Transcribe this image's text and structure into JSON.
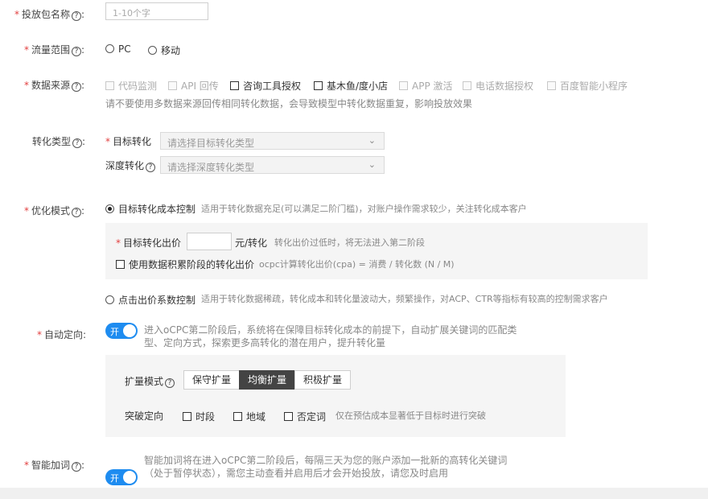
{
  "package_name": {
    "label": "投放包名称",
    "placeholder": "1-10个字"
  },
  "traffic": {
    "label": "流量范围",
    "options": [
      "PC",
      "移动"
    ]
  },
  "data_source": {
    "label": "数据来源",
    "options": [
      "代码监测",
      "API 回传",
      "咨询工具授权",
      "基木鱼/度小店",
      "APP 激活",
      "电话数据授权",
      "百度智能小程序"
    ],
    "note": "请不要使用多数据来源回传相同转化数据，会导致模型中转化数据重复，影响投放效果"
  },
  "conversion_type": {
    "label": "转化类型",
    "target_label": "目标转化",
    "target_placeholder": "请选择目标转化类型",
    "deep_label": "深度转化",
    "deep_placeholder": "请选择深度转化类型"
  },
  "optimization": {
    "label": "优化模式",
    "option1": "目标转化成本控制",
    "option1_desc": "适用于转化数据充足(可以满足二阶门槛)，对账户操作需求较少，关注转化成本客户",
    "bid_label": "目标转化出价",
    "bid_unit": "元/转化",
    "bid_hint": "转化出价过低时，将无法进入第二阶段",
    "accum_label": "使用数据积累阶段的转化出价",
    "accum_formula": "ocpc计算转化出价(cpa) = 消费 / 转化数 (N / M)",
    "option2": "点击出价系数控制",
    "option2_desc": "适用于转化数据稀疏，转化成本和转化量波动大，频繁操作，对ACP、CTR等指标有较高的控制需求客户"
  },
  "auto_targeting": {
    "label": "自动定向",
    "toggle": "开",
    "desc": "进入oCPC第二阶段后，系统将在保障目标转化成本的前提下，自动扩展关键词的匹配类型、定向方式，探索更多高转化的潜在用户，提升转化量",
    "expand_label": "扩量模式",
    "expand_modes": [
      "保守扩量",
      "均衡扩量",
      "积极扩量"
    ],
    "breakthrough_label": "突破定向",
    "breakthrough_options": [
      "时段",
      "地域",
      "否定词"
    ],
    "breakthrough_hint": "仅在预估成本显著低于目标时进行突破"
  },
  "smart_keywords": {
    "label": "智能加词",
    "toggle": "开",
    "desc": "智能加词将在进入oCPC第二阶段后，每隔三天为您的账户添加一批新的高转化关键词（处于暂停状态），需您主动查看并启用后才会开始投放，请您及时启用"
  },
  "help_glyph": "?",
  "required_mark": "*"
}
